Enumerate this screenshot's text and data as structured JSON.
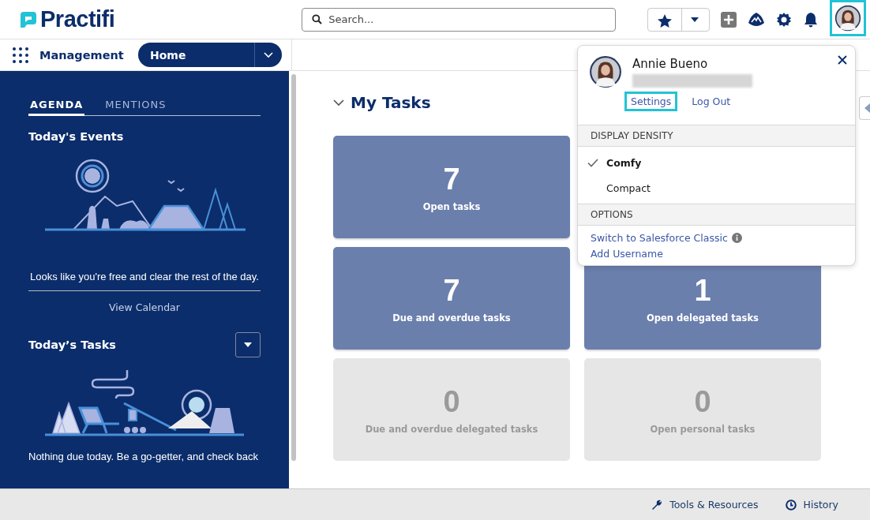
{
  "header": {
    "logo": "Practifi",
    "search": {
      "placeholder": "Search..."
    },
    "avatar": {
      "highlighted": true
    }
  },
  "nav": {
    "app_name": "Management",
    "tab": "Home"
  },
  "sidebar": {
    "tabs": [
      {
        "label": "AGENDA",
        "selected": true
      },
      {
        "label": "MENTIONS",
        "selected": false
      }
    ],
    "events_title": "Today's Events",
    "events_message": "Looks like you're free and clear the rest of the day.",
    "view_calendar": "View Calendar",
    "tasks_title": "Today’s Tasks",
    "tasks_message": "Nothing due today. Be a go-getter, and check back"
  },
  "main": {
    "title": "My Tasks",
    "expanded": true,
    "tiles": [
      {
        "count": "7",
        "label": "Open tasks",
        "active": true
      },
      {
        "count": "7",
        "label": "Due and overdue tasks",
        "active": true
      },
      {
        "count": "1",
        "label": "Open delegated tasks",
        "active": true
      },
      {
        "count": "0",
        "label": "Due and overdue delegated tasks",
        "active": false
      },
      {
        "count": "0",
        "label": "Open personal tasks",
        "active": false
      }
    ]
  },
  "user_menu": {
    "user_name": "Annie Bueno",
    "links": [
      {
        "label": "Settings",
        "highlighted": true
      },
      {
        "label": "Log Out",
        "highlighted": false
      }
    ],
    "sections": [
      {
        "heading": "DISPLAY DENSITY",
        "items": [
          {
            "kind": "choice",
            "label": "Comfy",
            "selected": true
          },
          {
            "kind": "choice",
            "label": "Compact",
            "selected": false
          }
        ]
      },
      {
        "heading": "OPTIONS",
        "items": [
          {
            "kind": "link",
            "label": "Switch to Salesforce Classic",
            "info": true
          },
          {
            "kind": "link",
            "label": "Add Username",
            "info": false
          }
        ]
      }
    ]
  },
  "footer": [
    {
      "kind": "wrench",
      "label": "Tools & Resources"
    },
    {
      "kind": "clock",
      "label": "History"
    }
  ]
}
